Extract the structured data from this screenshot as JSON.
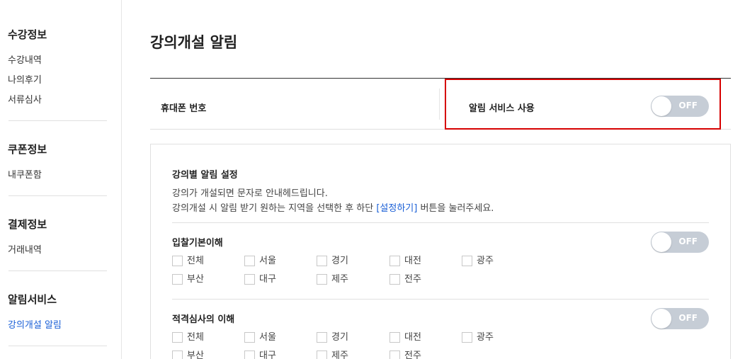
{
  "sidebar": {
    "groups": [
      {
        "title": "수강정보",
        "items": [
          "수강내역",
          "나의후기",
          "서류심사"
        ]
      },
      {
        "title": "쿠폰정보",
        "items": [
          "내쿠폰함"
        ]
      },
      {
        "title": "결제정보",
        "items": [
          "거래내역"
        ]
      },
      {
        "title": "알림서비스",
        "items": [
          "강의개설 알림"
        ]
      }
    ]
  },
  "page": {
    "title": "강의개설 알림"
  },
  "info": {
    "phone_label": "휴대폰 번호",
    "service_label": "알림 서비스 사용",
    "service_toggle": "OFF"
  },
  "settings": {
    "title": "강의별 알림 설정",
    "desc1": "강의가 개설되면 문자로 안내헤드립니다.",
    "desc2_prefix": "강의개설 시 알림 받기 원하는 지역을 선택한 후 하단 ",
    "desc2_link": "[설정하기]",
    "desc2_suffix": " 버튼을 눌러주세요.",
    "sections": [
      {
        "title": "입찰기본이해",
        "toggle": "OFF",
        "regions_row1": [
          "전체",
          "서울",
          "경기",
          "대전",
          "광주"
        ],
        "regions_row2": [
          "부산",
          "대구",
          "제주",
          "전주"
        ]
      },
      {
        "title": "적격심사의 이해",
        "toggle": "OFF",
        "regions_row1": [
          "전체",
          "서울",
          "경기",
          "대전",
          "광주"
        ],
        "regions_row2": [
          "부산",
          "대구",
          "제주",
          "전주"
        ]
      }
    ]
  },
  "colors": {
    "accent": "#1a5fd6",
    "highlight": "#d60000",
    "toggle_off": "#c6cdd6"
  }
}
